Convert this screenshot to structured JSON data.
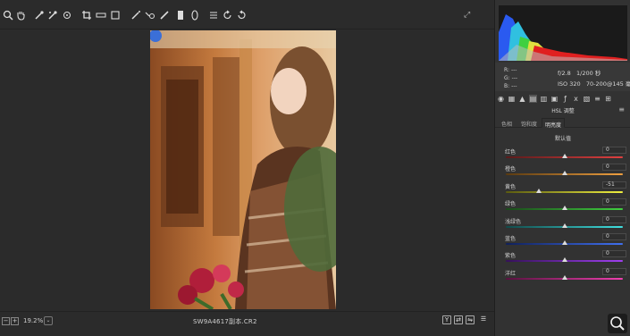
{
  "toolbar": {
    "tools": [
      {
        "name": "zoom-tool",
        "glyph": "🔍︎"
      },
      {
        "name": "hand-tool",
        "glyph": "✋︎"
      },
      {
        "name": "white-balance-tool",
        "glyph": "⁄"
      },
      {
        "name": "color-sampler-tool",
        "glyph": "⁄"
      },
      {
        "name": "targeted-adjustment-tool",
        "glyph": "◎"
      },
      {
        "name": "crop-tool",
        "glyph": "⌗"
      },
      {
        "name": "straighten-tool",
        "glyph": "▭"
      },
      {
        "name": "transform-tool",
        "glyph": "⌑"
      },
      {
        "name": "spot-removal-tool",
        "glyph": "⁄"
      },
      {
        "name": "red-eye-tool",
        "glyph": "+"
      },
      {
        "name": "adjustment-brush-tool",
        "glyph": "/"
      },
      {
        "name": "graduated-filter-tool",
        "glyph": "▮"
      },
      {
        "name": "radial-filter-tool",
        "glyph": "⬭"
      },
      {
        "name": "preferences",
        "glyph": "≡"
      },
      {
        "name": "rotate-ccw",
        "glyph": "↺"
      },
      {
        "name": "rotate-cw",
        "glyph": "↻"
      }
    ]
  },
  "bottom": {
    "zoom_out": "−",
    "zoom_in": "+",
    "zoom_value": "19.2%",
    "zoom_dropdown": "⌄",
    "filename": "SW9A4617副本.CR2",
    "view_y": "Y",
    "view_compare": "⇄",
    "view_swap": "⇋",
    "settings": "☰"
  },
  "panel": {
    "rgb_labels": [
      "R:",
      "G:",
      "B:"
    ],
    "rgb_values": [
      "---",
      "---",
      "---"
    ],
    "aperture": "f/2.8",
    "shutter": "1/200 秒",
    "iso": "ISO 320",
    "lens": "70-200@145 毫米",
    "section_title": "HSL 调整",
    "menu_icon": "≡",
    "tabs": [
      "色相",
      "饱和度",
      "明亮度"
    ],
    "active_tab": 2,
    "default_link": "默认值",
    "sliders": [
      {
        "label": "红色",
        "value": "0",
        "pos": 0.5,
        "gradient": "linear-gradient(90deg,#5a1a1a,#e04040)"
      },
      {
        "label": "橙色",
        "value": "0",
        "pos": 0.5,
        "gradient": "linear-gradient(90deg,#5a3a10,#f0a040)"
      },
      {
        "label": "黄色",
        "value": "-51",
        "pos": 0.28,
        "gradient": "linear-gradient(90deg,#5a5a10,#f0f040)"
      },
      {
        "label": "绿色",
        "value": "0",
        "pos": 0.5,
        "gradient": "linear-gradient(90deg,#1a4a1a,#40d040)"
      },
      {
        "label": "浅绿色",
        "value": "0",
        "pos": 0.5,
        "gradient": "linear-gradient(90deg,#104a4a,#40e0e0)"
      },
      {
        "label": "蓝色",
        "value": "0",
        "pos": 0.5,
        "gradient": "linear-gradient(90deg,#10205a,#4070f0)"
      },
      {
        "label": "紫色",
        "value": "0",
        "pos": 0.5,
        "gradient": "linear-gradient(90deg,#35105a,#a040f0)"
      },
      {
        "label": "洋红",
        "value": "0",
        "pos": 0.5,
        "gradient": "linear-gradient(90deg,#5a1040,#f040b0)"
      }
    ]
  }
}
